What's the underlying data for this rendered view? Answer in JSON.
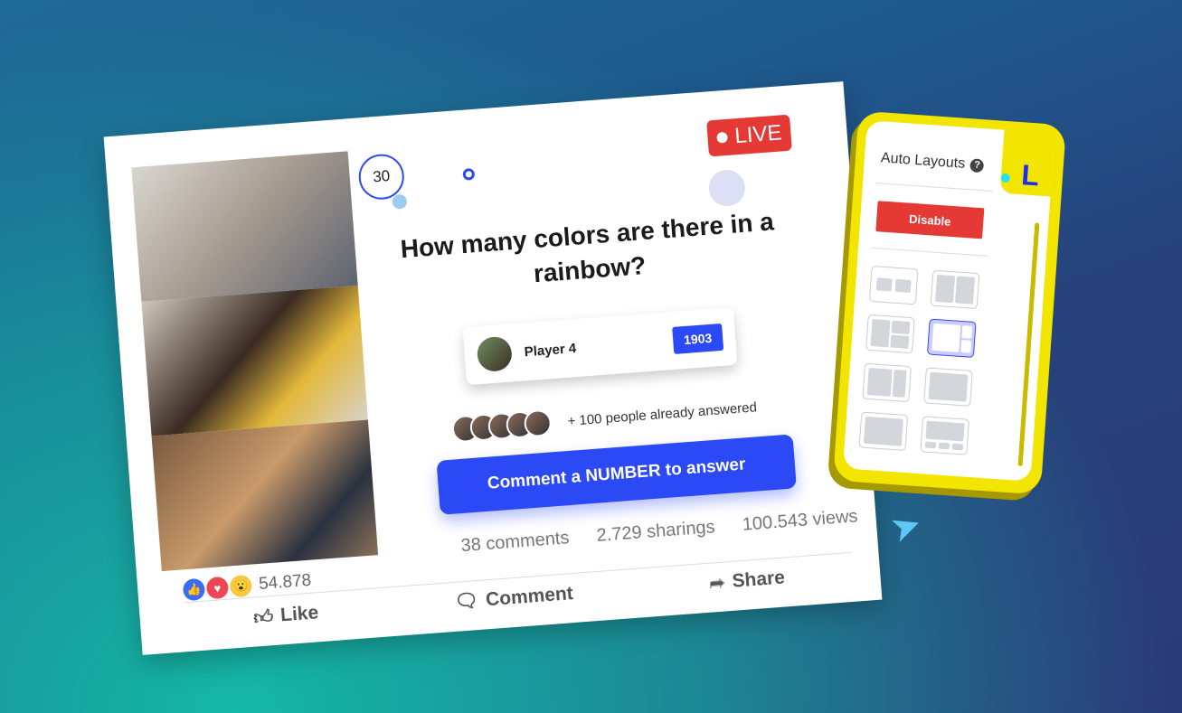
{
  "post": {
    "timer": "30",
    "live_label": "LIVE",
    "question": "How many colors are there in a rainbow?",
    "player": {
      "name": "Player 4",
      "score": "1903"
    },
    "answered_text": "+ 100 people already answered",
    "cta_label": "Comment a NUMBER to answer",
    "reaction_count": "54.878",
    "comments": "38 comments",
    "sharings": "2.729 sharings",
    "views": "100.543 views",
    "actions": {
      "like": "Like",
      "comment": "Comment",
      "share": "Share"
    }
  },
  "panel": {
    "title": "Auto Layouts",
    "help": "?",
    "disable_label": "Disable",
    "logo": "L",
    "selected_layout": 4
  },
  "colors": {
    "accent": "#2b49f5",
    "live": "#e53935",
    "panel": "#f2e600"
  }
}
